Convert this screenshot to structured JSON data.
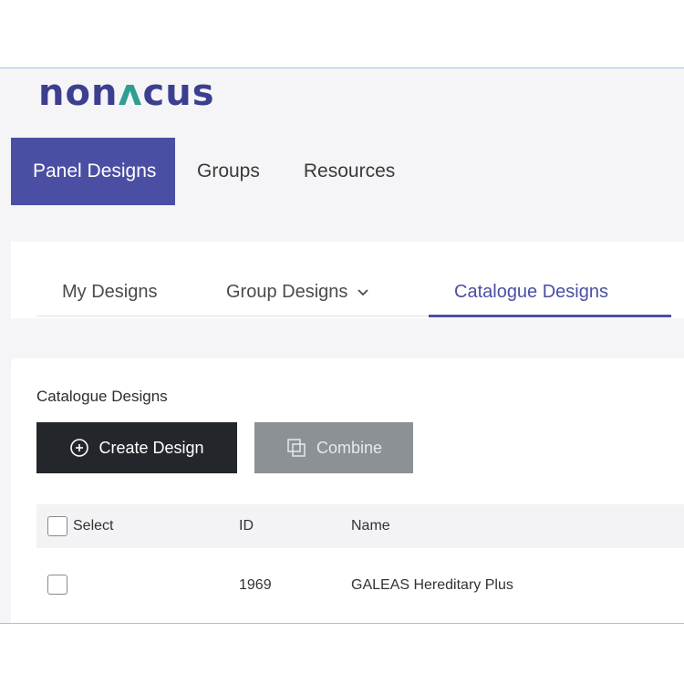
{
  "brand": {
    "logo_part1": "non",
    "logo_accent": "ʌ",
    "logo_part2": "cus"
  },
  "main_nav": {
    "items": [
      {
        "label": "Panel Designs",
        "active": true
      },
      {
        "label": "Groups",
        "active": false
      },
      {
        "label": "Resources",
        "active": false
      }
    ]
  },
  "sub_nav": {
    "tabs": [
      {
        "label": "My Designs"
      },
      {
        "label": "Group Designs"
      },
      {
        "label": "Catalogue Designs"
      }
    ]
  },
  "section": {
    "title": "Catalogue Designs",
    "create_label": "Create Design",
    "combine_label": "Combine"
  },
  "table": {
    "headers": {
      "select": "Select",
      "id": "ID",
      "name": "Name"
    },
    "rows": [
      {
        "id": "1969",
        "name": "GALEAS Hereditary Plus"
      }
    ]
  },
  "colors": {
    "accent": "#4a4fa3",
    "primary_button": "#23262b",
    "disabled_button": "#8c9196"
  }
}
